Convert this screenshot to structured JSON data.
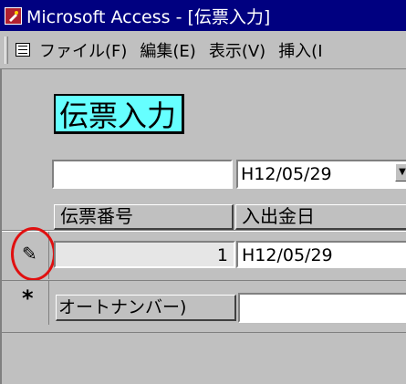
{
  "window": {
    "title": "Microsoft Access - [伝票入力]"
  },
  "menu": {
    "items": [
      "ファイル(F)",
      "編集(E)",
      "表示(V)",
      "挿入(I"
    ]
  },
  "form": {
    "title": "伝票入力",
    "filter": {
      "number_value": "",
      "date_value": "H12/05/29"
    },
    "columns": [
      "伝票番号",
      "入出金日"
    ],
    "current_row": {
      "number": "1",
      "date": "H12/05/29"
    },
    "new_row": {
      "number_placeholder": "オートナンバー)",
      "date": ""
    }
  }
}
